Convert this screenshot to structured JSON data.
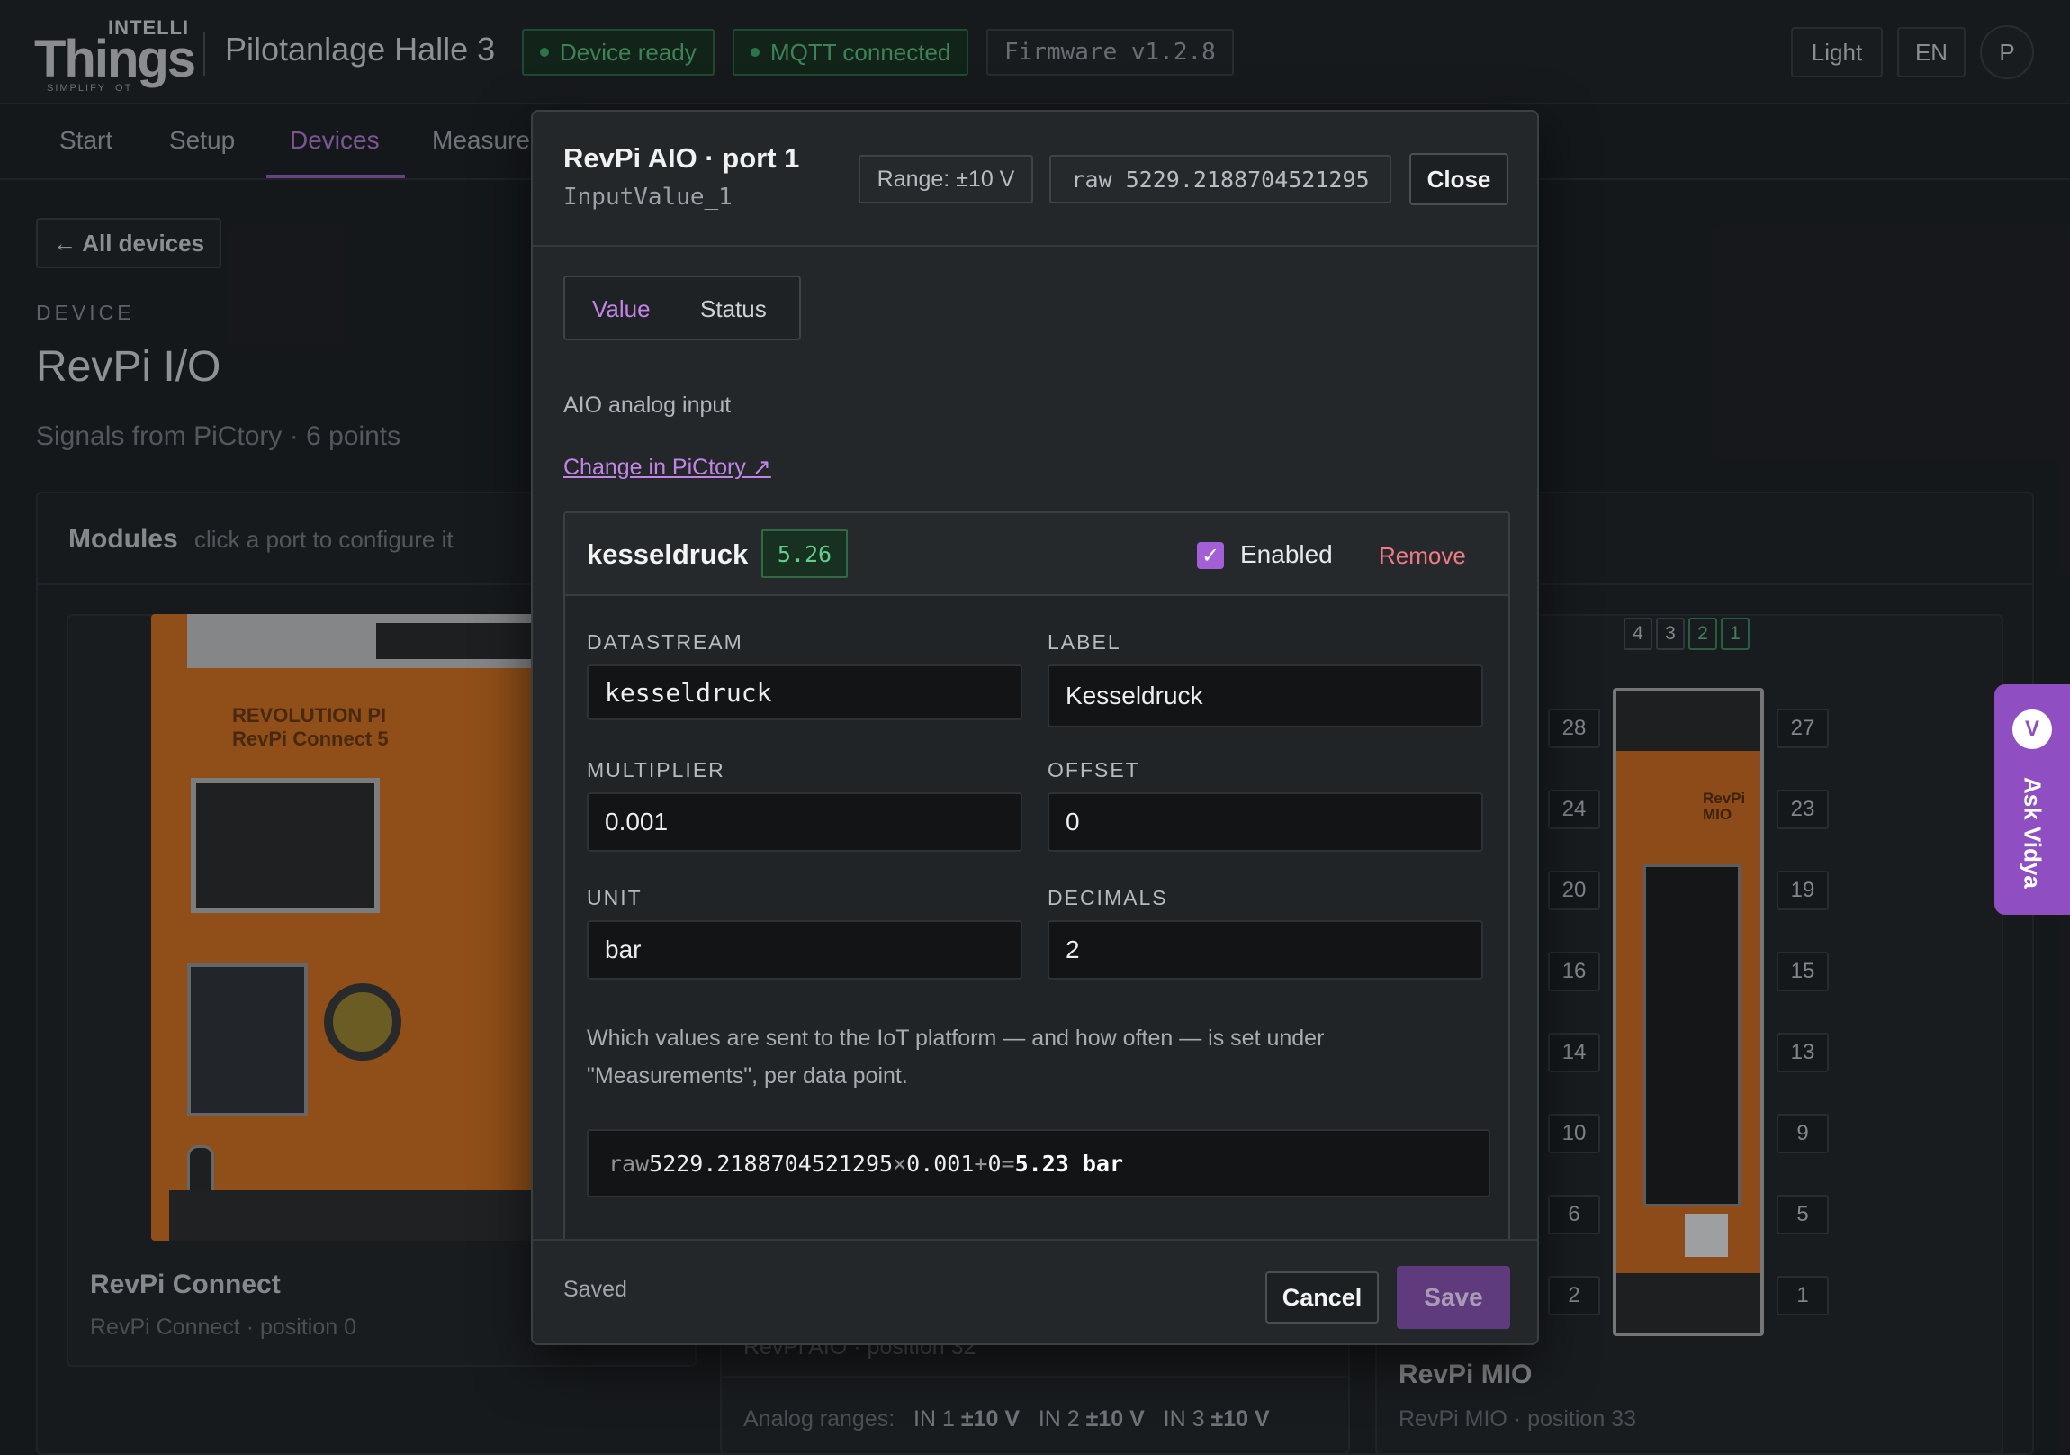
{
  "header": {
    "logo_top": "INTELLI",
    "logo_main": "Things",
    "logo_tagline": "SIMPLIFY IOT",
    "plant_name": "Pilotanlage Halle 3",
    "status_device": "Device ready",
    "status_mqtt": "MQTT connected",
    "firmware": "Firmware v1.2.8",
    "theme_button": "Light",
    "lang_button": "EN",
    "avatar_initial": "P"
  },
  "nav": {
    "tabs": [
      "Start",
      "Setup",
      "Devices",
      "Measure"
    ],
    "active_tab": "Devices"
  },
  "page": {
    "back_button": "← All devices",
    "eyebrow": "DEVICE",
    "title": "RevPi I/O",
    "subtitle": "Signals from PiCtory · 6 points",
    "modules_title": "Modules",
    "modules_hint": "click a port to configure it",
    "modules": [
      {
        "name": "RevPi Connect",
        "position": "RevPi Connect · position 0",
        "image_text": "REVOLUTION PI\nRevPi Connect 5"
      },
      {
        "name": "RevPi AIO",
        "position": "RevPi AIO · position 32"
      },
      {
        "name": "RevPi MIO",
        "position": "RevPi MIO · position 33",
        "image_text": "RevPi\nMIO"
      }
    ],
    "analog_ranges_label": "Analog ranges:",
    "analog_ranges": [
      {
        "port": "IN 1",
        "range": "±10 V"
      },
      {
        "port": "IN 2",
        "range": "±10 V"
      },
      {
        "port": "IN 3",
        "range": "±10 V"
      }
    ],
    "mio_pins_left": [
      "28",
      "24",
      "20",
      "16",
      "14",
      "10",
      "6",
      "2"
    ],
    "mio_pins_right": [
      "27",
      "23",
      "19",
      "15",
      "13",
      "9",
      "5",
      "1"
    ],
    "mio_top_pins": [
      "4",
      "3",
      "2",
      "1"
    ],
    "ask": {
      "initial": "V",
      "label": "Ask Vidya"
    }
  },
  "modal": {
    "title": "RevPi AIO · port 1",
    "subtitle": "InputValue_1",
    "range_chip": "Range: ±10 V",
    "raw_chip": "raw 5229.2188704521295",
    "close_button": "Close",
    "tabs": [
      "Value",
      "Status"
    ],
    "active_tab": "Value",
    "description": "AIO analog input",
    "link": "Change in PiCtory ↗",
    "datapoint": {
      "name": "kesseldruck",
      "live_value": "5.26",
      "enabled": true,
      "enabled_label": "Enabled",
      "remove_label": "Remove",
      "fields": {
        "datastream": {
          "label": "DATASTREAM",
          "value": "kesseldruck"
        },
        "label": {
          "label": "LABEL",
          "value": "Kesseldruck"
        },
        "multiplier": {
          "label": "MULTIPLIER",
          "value": "0.001"
        },
        "offset": {
          "label": "OFFSET",
          "value": "0"
        },
        "unit": {
          "label": "UNIT",
          "value": "bar"
        },
        "decimals": {
          "label": "DECIMALS",
          "value": "2"
        }
      },
      "help": "Which values are sent to the IoT platform — and how often — is set under \"Measurements\", per data point.",
      "formula": {
        "raw_label": "raw",
        "raw": "5229.2188704521295",
        "times": "×",
        "multiplier": "0.001",
        "plus": "+",
        "offset": "0",
        "equals": "=",
        "result": "5.23 bar"
      }
    },
    "footer": {
      "status": "Saved",
      "cancel": "Cancel",
      "save": "Save"
    }
  },
  "colors": {
    "accent": "#9b5fc4",
    "status_green": "#59c47f",
    "danger": "#f07a86"
  }
}
